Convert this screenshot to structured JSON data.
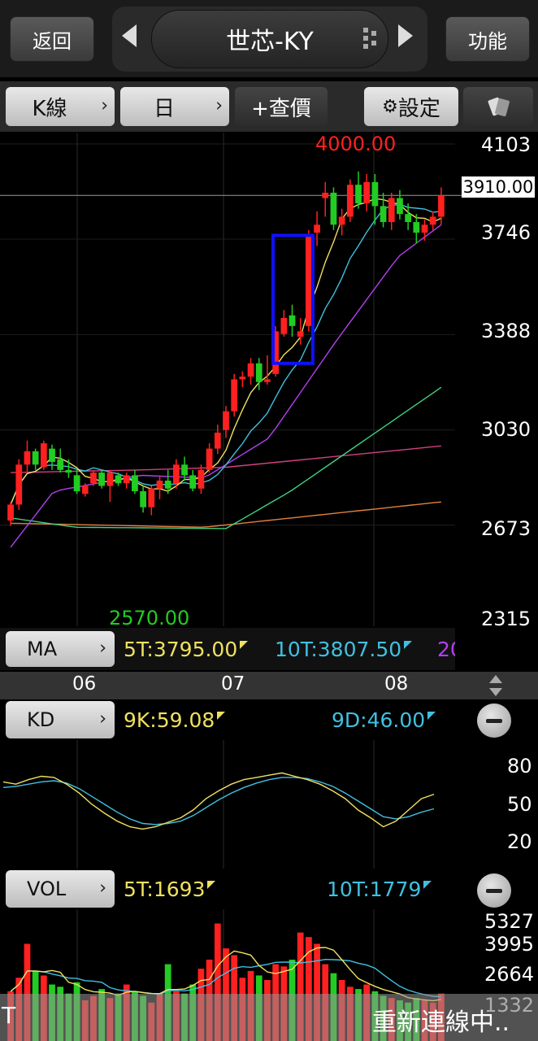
{
  "header": {
    "back_label": "返回",
    "title": "世芯-KY",
    "func_label": "功能"
  },
  "toolbar": {
    "chart_type": "K線",
    "period": "日",
    "add_quote": "+查價",
    "settings": "設定"
  },
  "price_panel": {
    "high_marker": "4000.00",
    "low_marker": "2570.00",
    "current_price": "3910.00",
    "y_ticks": [
      "4103",
      "3746",
      "3388",
      "3030",
      "2673",
      "2315"
    ]
  },
  "ma_row": {
    "label": "MA",
    "ma5": "5T:3795.00",
    "ma10": "10T:3807.50",
    "ma20_cut": "20"
  },
  "date_axis": {
    "labels": [
      "06",
      "07",
      "08"
    ]
  },
  "kd_panel": {
    "label": "KD",
    "k": "9K:59.08",
    "d": "9D:46.00",
    "y_ticks": [
      "80",
      "50",
      "20"
    ]
  },
  "vol_panel": {
    "label": "VOL",
    "vol5": "5T:1693",
    "vol10": "10T:1779",
    "y_ticks": [
      "5327",
      "3995",
      "2664",
      "1332"
    ]
  },
  "status": {
    "left_char": "T",
    "message": "重新連線中.."
  },
  "colors": {
    "up": "#ff2020",
    "down": "#22cc22",
    "ma5": "#f0e060",
    "ma10": "#40c0e0",
    "ma20": "#b040f0",
    "ma60": "#40d080",
    "ma120": "#d04080",
    "ma240": "#e08040",
    "highlight": "#1010ff"
  },
  "chart_data": {
    "type": "candlestick",
    "ylim": [
      2315,
      4103
    ],
    "candles": [
      [
        2690,
        2760,
        2670,
        2750
      ],
      [
        2750,
        2920,
        2730,
        2900
      ],
      [
        2900,
        2990,
        2870,
        2950
      ],
      [
        2950,
        2960,
        2880,
        2900
      ],
      [
        2890,
        2990,
        2880,
        2980
      ],
      [
        2960,
        2975,
        2880,
        2910
      ],
      [
        2920,
        2960,
        2870,
        2880
      ],
      [
        2880,
        2920,
        2850,
        2870
      ],
      [
        2860,
        2880,
        2790,
        2800
      ],
      [
        2790,
        2830,
        2780,
        2820
      ],
      [
        2830,
        2880,
        2820,
        2870
      ],
      [
        2870,
        2880,
        2810,
        2820
      ],
      [
        2820,
        2880,
        2760,
        2870
      ],
      [
        2860,
        2870,
        2820,
        2830
      ],
      [
        2830,
        2870,
        2810,
        2860
      ],
      [
        2860,
        2880,
        2790,
        2800
      ],
      [
        2800,
        2820,
        2720,
        2740
      ],
      [
        2740,
        2820,
        2710,
        2810
      ],
      [
        2810,
        2860,
        2770,
        2840
      ],
      [
        2840,
        2880,
        2790,
        2810
      ],
      [
        2830,
        2920,
        2810,
        2900
      ],
      [
        2900,
        2930,
        2840,
        2860
      ],
      [
        2860,
        2880,
        2800,
        2810
      ],
      [
        2810,
        2900,
        2790,
        2880
      ],
      [
        2880,
        2980,
        2870,
        2960
      ],
      [
        2960,
        3050,
        2940,
        3020
      ],
      [
        3030,
        3120,
        3000,
        3100
      ],
      [
        3100,
        3240,
        3080,
        3220
      ],
      [
        3220,
        3250,
        3190,
        3230
      ],
      [
        3230,
        3300,
        3200,
        3280
      ],
      [
        3280,
        3300,
        3180,
        3210
      ],
      [
        3210,
        3310,
        3200,
        3220
      ],
      [
        3240,
        3420,
        3230,
        3400
      ],
      [
        3390,
        3480,
        3380,
        3450
      ],
      [
        3460,
        3500,
        3380,
        3420
      ],
      [
        3380,
        3450,
        3350,
        3400
      ],
      [
        3420,
        3780,
        3400,
        3760
      ],
      [
        3770,
        3850,
        3720,
        3800
      ],
      [
        3900,
        3960,
        3830,
        3920
      ],
      [
        3920,
        3940,
        3780,
        3800
      ],
      [
        3800,
        3860,
        3760,
        3830
      ],
      [
        3830,
        3970,
        3810,
        3950
      ],
      [
        3950,
        4000,
        3860,
        3880
      ],
      [
        3880,
        3990,
        3850,
        3960
      ],
      [
        3960,
        3990,
        3800,
        3870
      ],
      [
        3870,
        3920,
        3790,
        3810
      ],
      [
        3810,
        3920,
        3780,
        3900
      ],
      [
        3900,
        3930,
        3820,
        3840
      ],
      [
        3840,
        3880,
        3780,
        3810
      ],
      [
        3810,
        3840,
        3730,
        3770
      ],
      [
        3770,
        3820,
        3740,
        3800
      ],
      [
        3800,
        3850,
        3780,
        3830
      ],
      [
        3830,
        3940,
        3800,
        3910
      ]
    ],
    "kd": {
      "k": [
        70,
        68,
        72,
        75,
        74,
        68,
        60,
        50,
        42,
        35,
        30,
        28,
        30,
        34,
        38,
        45,
        55,
        62,
        68,
        72,
        74,
        76,
        78,
        75,
        72,
        68,
        62,
        55,
        45,
        38,
        30,
        35,
        45,
        55,
        59
      ],
      "d": [
        65,
        66,
        68,
        70,
        71,
        69,
        64,
        57,
        50,
        43,
        37,
        33,
        32,
        33,
        35,
        40,
        47,
        54,
        60,
        65,
        69,
        72,
        74,
        74,
        73,
        70,
        66,
        60,
        53,
        46,
        39,
        37,
        39,
        43,
        46
      ],
      "ylim": [
        0,
        100
      ]
    },
    "volume": [
      2200,
      2800,
      4300,
      3100,
      2900,
      2500,
      2400,
      2100,
      2600,
      1800,
      2000,
      2300,
      1900,
      2100,
      2500,
      2200,
      2000,
      1700,
      2100,
      3400,
      2200,
      2100,
      2500,
      3200,
      3600,
      5200,
      4100,
      3800,
      2800,
      3100,
      2900,
      2700,
      3400,
      3300,
      3600,
      4800,
      4600,
      4300,
      3400,
      3000,
      2700,
      2400,
      2300,
      2500,
      2200,
      2000,
      1900,
      1800,
      1700,
      1900,
      1800,
      1700,
      2100
    ],
    "vol_ylim": [
      1332,
      5327
    ]
  }
}
